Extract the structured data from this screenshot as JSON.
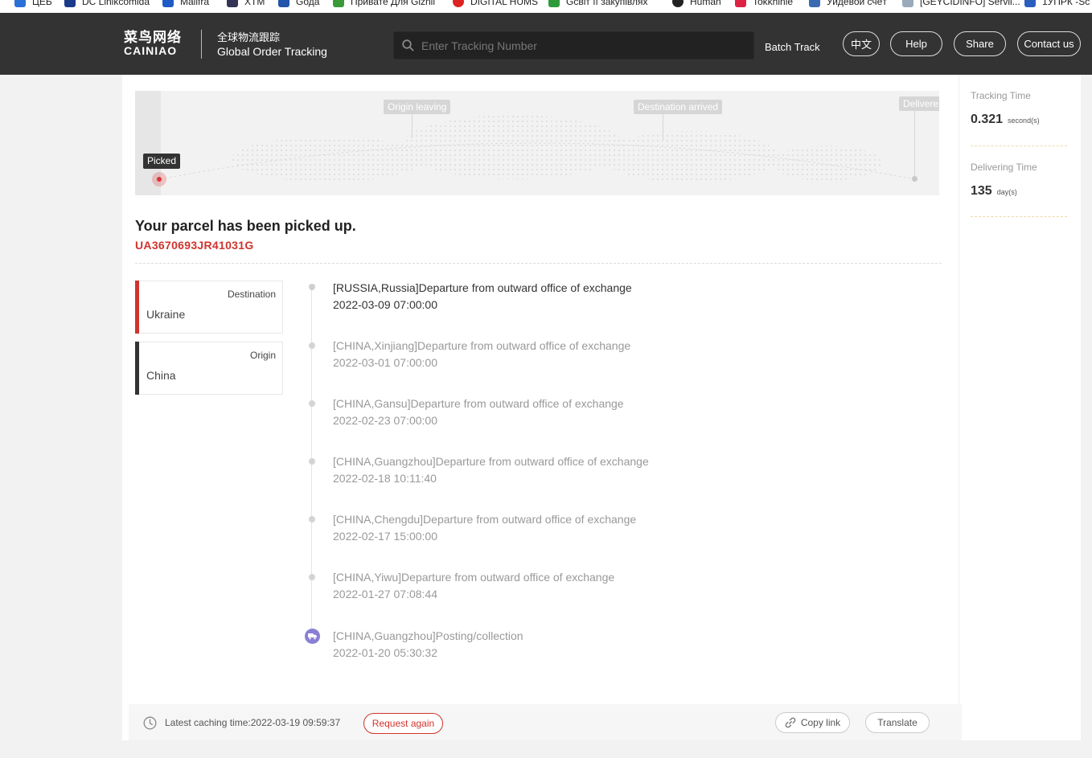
{
  "bookmarks": [
    {
      "label": "ЦЕБ",
      "color": "#2a6fd6"
    },
    {
      "label": "DC Linikcomida",
      "color": "#1a3a8a"
    },
    {
      "label": "Mailfra",
      "color": "#1e5bc6"
    },
    {
      "label": "XTM",
      "color": "#335"
    },
    {
      "label": "Gода",
      "color": "#2255aa"
    },
    {
      "label": "Привате Для Giznil",
      "color": "#3a9a3a"
    },
    {
      "label": "DIGITAL HUMS",
      "color": "#dd2222"
    },
    {
      "label": "Gсвіт її закупівлях",
      "color": "#2e9a3a"
    },
    {
      "label": "Human",
      "color": "#222"
    },
    {
      "label": "Tokkhinie",
      "color": "#d24"
    },
    {
      "label": "Уйдевой счёт",
      "color": "#3a6ab0"
    },
    {
      "label": "[GEYCIDINFO] Servil...",
      "color": "#9ab"
    },
    {
      "label": "1УПРК -Sc",
      "color": "#2a5fc0"
    }
  ],
  "header": {
    "logo_cn": "菜鸟网络",
    "logo_en": "CAINIAO",
    "subtitle_cn": "全球物流跟踪",
    "subtitle_en": "Global Order Tracking",
    "search_placeholder": "Enter Tracking Number",
    "batch_track": "Batch Track",
    "buttons": {
      "lang": "中文",
      "help": "Help",
      "share": "Share",
      "contact": "Contact us"
    }
  },
  "map": {
    "labels": {
      "origin_leaving": "Origin leaving",
      "destination_arrived": "Destination arrived",
      "delivered": "Delivere"
    },
    "current": "Picked"
  },
  "parcel": {
    "status": "Your parcel has been picked up.",
    "tracking_number": "UA3670693JR41031G"
  },
  "cards": {
    "destination": {
      "role": "Destination",
      "country": "Ukraine"
    },
    "origin": {
      "role": "Origin",
      "country": "China"
    }
  },
  "timeline": [
    {
      "text": "[RUSSIA,Russia]Departure from outward office of exchange",
      "time": "2022-03-09 07:00:00"
    },
    {
      "text": "[CHINA,Xinjiang]Departure from outward office of exchange",
      "time": "2022-03-01 07:00:00"
    },
    {
      "text": "[CHINA,Gansu]Departure from outward office of exchange",
      "time": "2022-02-23 07:00:00"
    },
    {
      "text": "[CHINA,Guangzhou]Departure from outward office of exchange",
      "time": "2022-02-18 10:11:40"
    },
    {
      "text": "[CHINA,Chengdu]Departure from outward office of exchange",
      "time": "2022-02-17 15:00:00"
    },
    {
      "text": "[CHINA,Yiwu]Departure from outward office of exchange",
      "time": "2022-01-27 07:08:44"
    },
    {
      "text": "[CHINA,Guangzhou]Posting/collection",
      "time": "2022-01-20 05:30:32"
    }
  ],
  "footer": {
    "cache_text": "Latest caching time:2022-03-19 09:59:37",
    "request_again": "Request again",
    "copy_link": "Copy link",
    "translate": "Translate"
  },
  "stats": {
    "tracking_time": {
      "label": "Tracking Time",
      "value": "0.321",
      "unit": "second(s)"
    },
    "delivering_time": {
      "label": "Delivering Time",
      "value": "135",
      "unit": "day(s)"
    }
  },
  "colors": {
    "header_bg": "#333333",
    "accent_red": "#d0342c",
    "origin_purple": "#8a7fd6"
  }
}
